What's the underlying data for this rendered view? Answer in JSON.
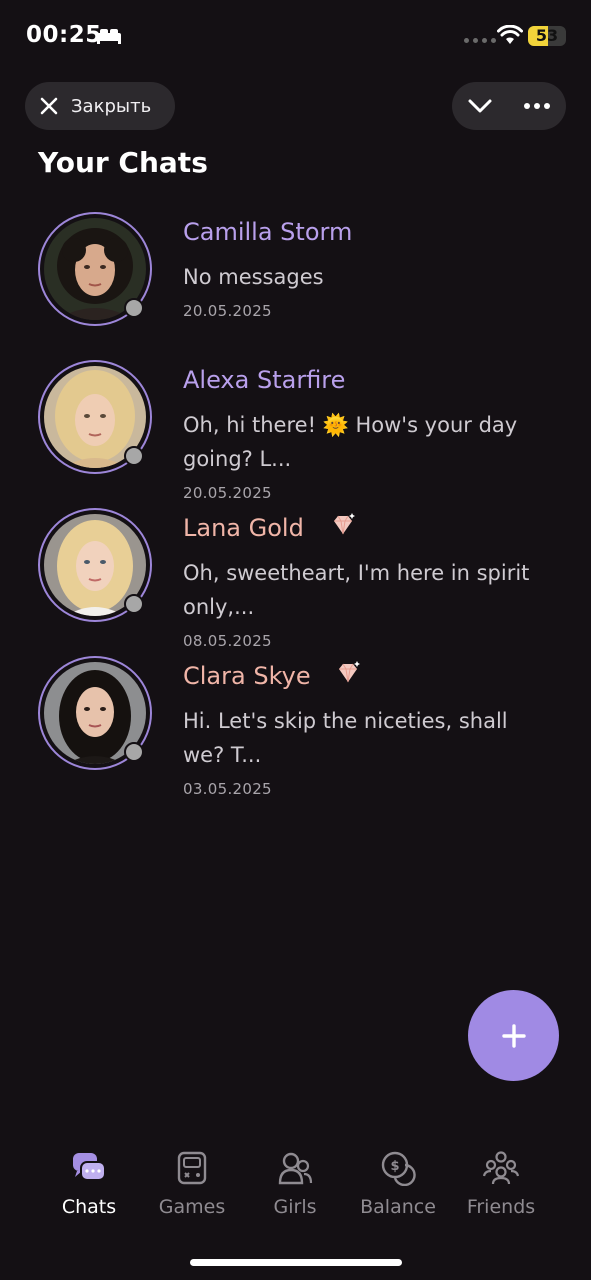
{
  "status_bar": {
    "time": "00:25",
    "battery_level": "53",
    "battery_fraction": 0.53
  },
  "header": {
    "close_label": "Закрыть",
    "title": "Your Chats"
  },
  "colors": {
    "background": "#141014",
    "accent": "#a08ae4",
    "name_purple": "#b9a0ec",
    "name_premium": "#f0b5a8"
  },
  "chats": [
    {
      "name": "Camilla Storm",
      "message": "No messages",
      "date": "20.05.2025",
      "premium": false
    },
    {
      "name": "Alexa Starfire",
      "message": "Oh, hi there! 🌞 How's your day going? L...",
      "date": "20.05.2025",
      "premium": false
    },
    {
      "name": "Lana Gold",
      "message": "Oh, sweetheart, I'm here in spirit only,...",
      "date": "08.05.2025",
      "premium": true
    },
    {
      "name": "Clara Skye",
      "message": "Hi. Let's skip the niceties, shall we? T...",
      "date": "03.05.2025",
      "premium": true
    }
  ],
  "fab": {
    "icon": "plus-icon"
  },
  "nav": [
    {
      "label": "Chats",
      "icon": "chats-icon",
      "active": true
    },
    {
      "label": "Games",
      "icon": "games-icon",
      "active": false
    },
    {
      "label": "Girls",
      "icon": "girls-icon",
      "active": false
    },
    {
      "label": "Balance",
      "icon": "balance-icon",
      "active": false
    },
    {
      "label": "Friends",
      "icon": "friends-icon",
      "active": false
    }
  ]
}
